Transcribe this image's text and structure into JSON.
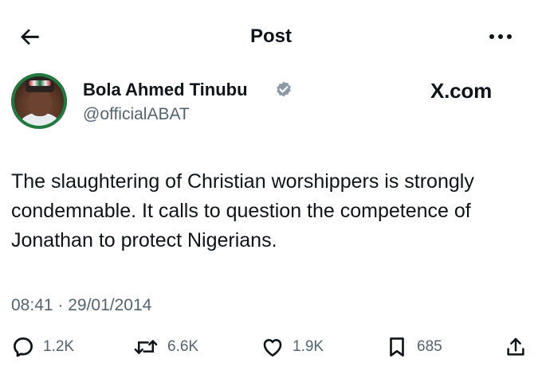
{
  "header": {
    "title": "Post",
    "back_icon": "arrow-left-icon",
    "more_icon": "more-horizontal-icon"
  },
  "author": {
    "name": "Bola Ahmed Tinubu",
    "handle": "@officialABAT",
    "verified": true,
    "verified_color": "#1d9bf0"
  },
  "source_watermark": "X.com",
  "tweet": {
    "text": "The slaughtering of Christian worshippers  is strongly condemnable. It calls to question the competence of Jonathan to protect Nigerians.",
    "timestamp": "08:41 · 29/01/2014"
  },
  "actions": {
    "replies": "1.2K",
    "reposts": "6.6K",
    "likes": "1.9K",
    "bookmarks": "685"
  }
}
